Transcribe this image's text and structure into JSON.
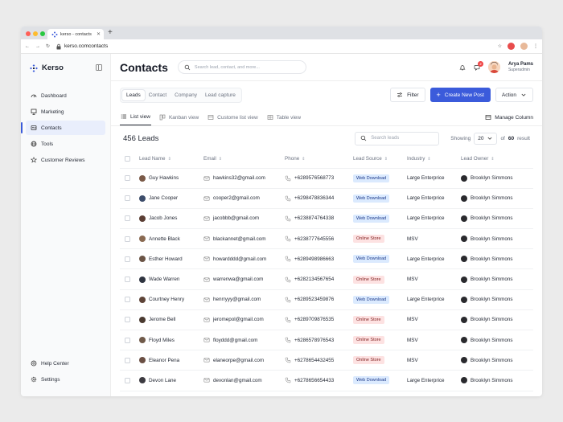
{
  "browser": {
    "tab_title": "kerso - contacts",
    "url": "kerso.comcontacts"
  },
  "app": {
    "brand": "Kerso",
    "page_title": "Contacts",
    "search_placeholder": "Search lead, contact, and more...",
    "notification_count": "2",
    "user": {
      "name": "Arya Pams",
      "role": "Superadmin"
    }
  },
  "sidebar": {
    "items": [
      {
        "label": "Dashboard",
        "icon": "dashboard-icon"
      },
      {
        "label": "Marketing",
        "icon": "marketing-icon"
      },
      {
        "label": "Contacts",
        "icon": "contacts-icon",
        "active": true
      },
      {
        "label": "Tools",
        "icon": "globe-icon"
      },
      {
        "label": "Customer Reviews",
        "icon": "star-icon"
      }
    ],
    "bottom": [
      {
        "label": "Help Center",
        "icon": "help-icon"
      },
      {
        "label": "Settings",
        "icon": "gear-icon"
      }
    ]
  },
  "segments": [
    "Leads",
    "Contact",
    "Company",
    "Lead capture"
  ],
  "actions": {
    "filter": "Filter",
    "create": "Create New Post",
    "action": "Action"
  },
  "views": [
    "List view",
    "Kanban view",
    "Custome list view",
    "Table view"
  ],
  "manage_column": "Manage Column",
  "summary": {
    "count": "456 Leads",
    "search_placeholder": "Search leads",
    "showing_label": "Showing",
    "page_size": "20",
    "of_prefix": "of",
    "total": "60",
    "result_label": "result"
  },
  "table": {
    "columns": [
      "Lead Name",
      "Email",
      "Phone",
      "Lead Source",
      "Industry",
      "Lead Owner"
    ],
    "rows": [
      {
        "name": "Guy Hawkins",
        "email": "hawkins32@gmail.com",
        "phone": "+6289576568773",
        "source": "Web Download",
        "industry": "Large Enterprice",
        "owner": "Brooklyn Simmons"
      },
      {
        "name": "Jane Cooper",
        "email": "cooper2@gmail.com",
        "phone": "+6298478836344",
        "source": "Web Download",
        "industry": "Large Enterprice",
        "owner": "Brooklyn Simmons"
      },
      {
        "name": "Jacob Jones",
        "email": "jacobbb@gmail.com",
        "phone": "+6238874764338",
        "source": "Web Download",
        "industry": "Large Enterprice",
        "owner": "Brooklyn Simmons"
      },
      {
        "name": "Annette Black",
        "email": "blackannet@gmail.com",
        "phone": "+6238777645556",
        "source": "Online Store",
        "industry": "MSV",
        "owner": "Brooklyn Simmons"
      },
      {
        "name": "Esther Howard",
        "email": "howardddd@gmail.com",
        "phone": "+6289498986663",
        "source": "Web Download",
        "industry": "Large Enterprice",
        "owner": "Brooklyn Simmons"
      },
      {
        "name": "Wade Warren",
        "email": "warrenwa@gmail.com",
        "phone": "+6282134567654",
        "source": "Online Store",
        "industry": "MSV",
        "owner": "Brooklyn Simmons"
      },
      {
        "name": "Courtney Henry",
        "email": "henrryyy@gmail.com",
        "phone": "+6289523459876",
        "source": "Web Download",
        "industry": "Large Enterprice",
        "owner": "Brooklyn Simmons"
      },
      {
        "name": "Jerome Bell",
        "email": "jeromepol@gmail.com",
        "phone": "+6289709876535",
        "source": "Online Store",
        "industry": "MSV",
        "owner": "Brooklyn Simmons"
      },
      {
        "name": "Floyd Miles",
        "email": "floyddd@gmail.com",
        "phone": "+6286578976543",
        "source": "Online Store",
        "industry": "MSV",
        "owner": "Brooklyn Simmons"
      },
      {
        "name": "Eleanor Pena",
        "email": "elaneorpe@gmail.com",
        "phone": "+6278654432455",
        "source": "Online Store",
        "industry": "MSV",
        "owner": "Brooklyn Simmons"
      },
      {
        "name": "Devon Lane",
        "email": "devonlan@gmail.com",
        "phone": "+6278656654433",
        "source": "Web Download",
        "industry": "Large Enterprice",
        "owner": "Brooklyn Simmons"
      }
    ]
  },
  "colors": {
    "accent": "#3b5bdb",
    "web_download_bg": "#dbeafe",
    "online_store_bg": "#fde2e2"
  }
}
